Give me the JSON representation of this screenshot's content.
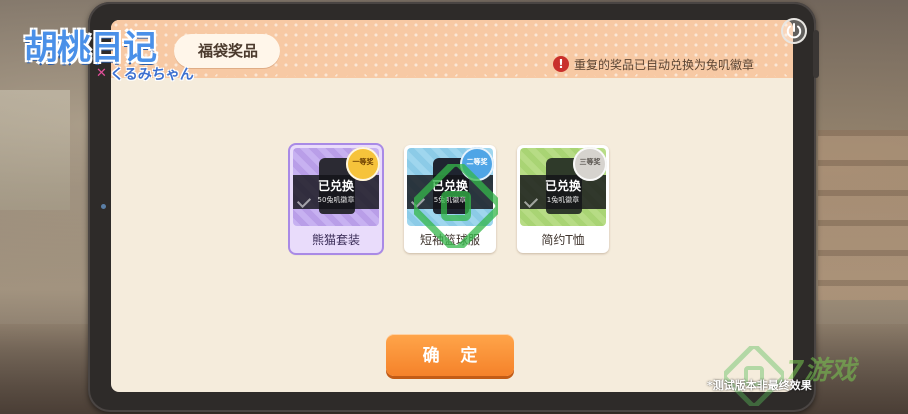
{
  "logo": {
    "main": "胡桃日记",
    "cross": "✕",
    "sub": "くるみちゃん"
  },
  "dialog": {
    "title": "福袋奖品",
    "notice_icon": "!",
    "notice": "重复的奖品已自动兑换为兔叽徽章"
  },
  "prizes": [
    {
      "rank": "一等奖",
      "status": "已兑换",
      "reward": "50兔叽徽章",
      "name": "熊猫套装",
      "rank_color": "#f6c33b",
      "icon": "panda-outfit-icon"
    },
    {
      "rank": "二等奖",
      "status": "已兑换",
      "reward": "5兔叽徽章",
      "name": "短袖篮球服",
      "rank_color": "#4fa5e6",
      "icon": "basketball-jersey-icon"
    },
    {
      "rank": "三等奖",
      "status": "已兑换",
      "reward": "1兔叽徽章",
      "name": "简约T恤",
      "rank_color": "#d6d3ce",
      "icon": "t-shirt-icon"
    }
  ],
  "actions": {
    "confirm": "确 定",
    "power_icon": "power-icon"
  },
  "footer": {
    "note": "*测试版本非最终效果",
    "watermark": "7游戏"
  },
  "colors": {
    "accent": "#f5822a",
    "header": "#f7c9a4",
    "panel": "#f5ecdc"
  }
}
